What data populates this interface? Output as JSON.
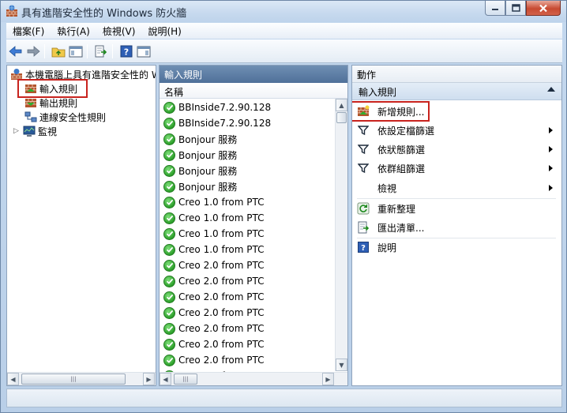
{
  "window": {
    "title": "具有進階安全性的 Windows 防火牆"
  },
  "menu": [
    "檔案(F)",
    "執行(A)",
    "檢視(V)",
    "說明(H)"
  ],
  "tree": {
    "root": "本機電腦上具有進階安全性的 W",
    "items": [
      "輸入規則",
      "輸出規則",
      "連線安全性規則",
      "監視"
    ]
  },
  "middle": {
    "header": "輸入規則",
    "column": "名稱",
    "rows": [
      "BBInside7.2.90.128",
      "BBInside7.2.90.128",
      "Bonjour 服務",
      "Bonjour 服務",
      "Bonjour 服務",
      "Bonjour 服務",
      "Creo 1.0 from PTC",
      "Creo 1.0 from PTC",
      "Creo 1.0 from PTC",
      "Creo 1.0 from PTC",
      "Creo 2.0 from PTC",
      "Creo 2.0 from PTC",
      "Creo 2.0 from PTC",
      "Creo 2.0 from PTC",
      "Creo 2.0 from PTC",
      "Creo 2.0 from PTC",
      "Creo 2.0 from PTC",
      "Creo 2.0 from PTC"
    ]
  },
  "actions": {
    "header": "動作",
    "section": "輸入規則",
    "items": [
      {
        "label": "新增規則...",
        "icon": "new-rule-icon"
      },
      {
        "label": "依設定檔篩選",
        "icon": "filter-icon"
      },
      {
        "label": "依狀態篩選",
        "icon": "filter-icon"
      },
      {
        "label": "依群組篩選",
        "icon": "filter-icon"
      },
      {
        "label": "檢視",
        "icon": ""
      },
      {
        "label": "重新整理",
        "icon": "refresh-icon"
      },
      {
        "label": "匯出清單...",
        "icon": "export-icon"
      },
      {
        "label": "說明",
        "icon": "help-icon"
      }
    ]
  },
  "colors": {
    "highlight": "#c8231e",
    "pane_header": "#4f7099",
    "enabled_rule": "#2c9f2a"
  }
}
